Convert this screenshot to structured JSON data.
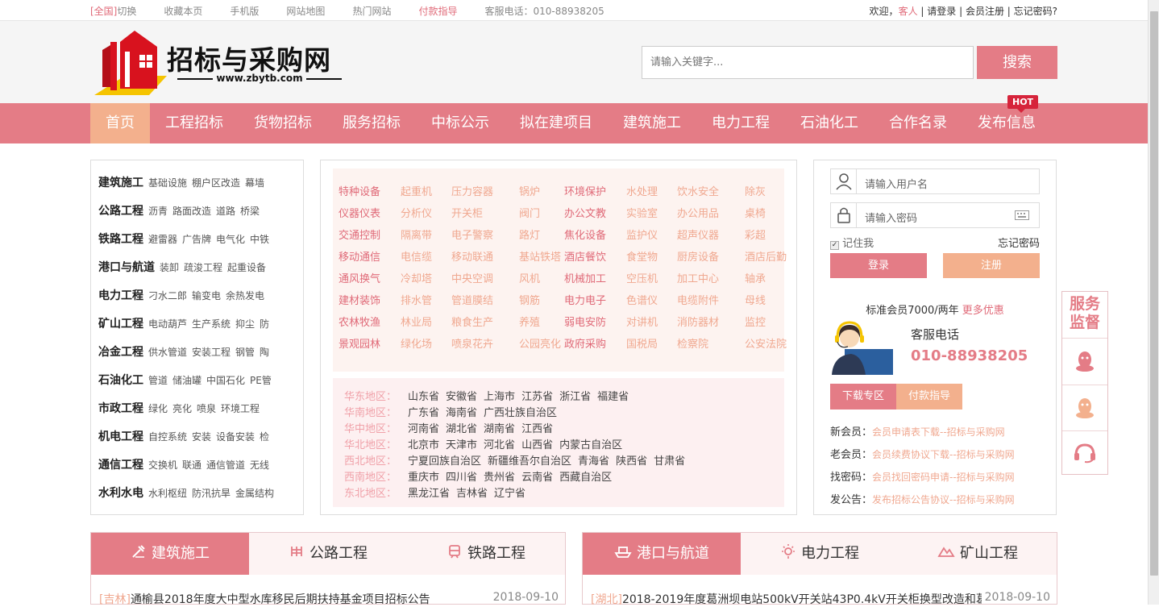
{
  "topbar": {
    "region_tag": "[全国]",
    "switch": "切换",
    "links": [
      "收藏本页",
      "手机版",
      "网站地图",
      "热门网站",
      "付款指导"
    ],
    "hotline": "客服电话：010-88938205",
    "welcome": "欢迎，",
    "guest": "客人",
    "login": "请登录",
    "register": "会员注册",
    "forgot": "忘记密码?"
  },
  "header": {
    "logo_title": "招标与采购网",
    "logo_url": "www.zbytb.com",
    "search_placeholder": "请输入关键字...",
    "search_button": "搜索"
  },
  "nav": {
    "items": [
      "首页",
      "工程招标",
      "货物招标",
      "服务招标",
      "中标公示",
      "拟在建项目",
      "建筑施工",
      "电力工程",
      "石油化工",
      "合作名录",
      "发布信息"
    ],
    "hot_badge": "HOT"
  },
  "categories": [
    {
      "name": "建筑施工",
      "subs": [
        "基础设施",
        "棚户区改造",
        "幕墙"
      ]
    },
    {
      "name": "公路工程",
      "subs": [
        "沥青",
        "路面改造",
        "道路",
        "桥梁"
      ]
    },
    {
      "name": "铁路工程",
      "subs": [
        "避雷器",
        "广告牌",
        "电气化",
        "中铁"
      ]
    },
    {
      "name": "港口与航道",
      "subs": [
        "装卸",
        "疏浚工程",
        "起重设备"
      ]
    },
    {
      "name": "电力工程",
      "subs": [
        "刁水二郎",
        "输变电",
        "余热发电"
      ]
    },
    {
      "name": "矿山工程",
      "subs": [
        "电动葫芦",
        "生产系统",
        "抑尘",
        "防"
      ]
    },
    {
      "name": "冶金工程",
      "subs": [
        "供水管道",
        "安装工程",
        "钢管",
        "陶"
      ]
    },
    {
      "name": "石油化工",
      "subs": [
        "管道",
        "储油罐",
        "中国石化",
        "PE管"
      ]
    },
    {
      "name": "市政工程",
      "subs": [
        "绿化",
        "亮化",
        "喷泉",
        "环境工程"
      ]
    },
    {
      "name": "机电工程",
      "subs": [
        "自控系统",
        "安装",
        "设备安装",
        "检"
      ]
    },
    {
      "name": "通信工程",
      "subs": [
        "交换机",
        "联通",
        "通信管道",
        "无线"
      ]
    },
    {
      "name": "水利水电",
      "subs": [
        "水利枢纽",
        "防汛抗旱",
        "金属结构"
      ]
    }
  ],
  "tags": [
    [
      "特种设备",
      "起重机",
      "压力容器",
      "锅炉",
      "环境保护",
      "水处理",
      "饮水安全",
      "除灰"
    ],
    [
      "仪器仪表",
      "分析仪",
      "开关柜",
      "阀门",
      "办公文教",
      "实验室",
      "办公用品",
      "桌椅"
    ],
    [
      "交通控制",
      "隔离带",
      "电子警察",
      "路灯",
      "焦化设备",
      "监护仪",
      "超声仪器",
      "彩超"
    ],
    [
      "移动通信",
      "电信缆",
      "移动联通",
      "基站铁塔",
      "酒店餐饮",
      "食堂物",
      "厨房设备",
      "酒店后勤"
    ],
    [
      "通风换气",
      "冷却塔",
      "中央空调",
      "风机",
      "机械加工",
      "空压机",
      "加工中心",
      "轴承"
    ],
    [
      "建材装饰",
      "排水管",
      "管道膜结",
      "钢筋",
      "电力电子",
      "色谱仪",
      "电缆附件",
      "母线"
    ],
    [
      "农林牧渔",
      "林业局",
      "粮食生产",
      "养殖",
      "弱电安防",
      "对讲机",
      "消防器材",
      "监控"
    ],
    [
      "景观园林",
      "绿化场",
      "喷泉花卉",
      "公园亮化",
      "政府采购",
      "国税局",
      "检察院",
      "公安法院"
    ]
  ],
  "regions": [
    {
      "name": "华东地区：",
      "provinces": [
        "山东省",
        "安徽省",
        "上海市",
        "江苏省",
        "浙江省",
        "福建省"
      ]
    },
    {
      "name": "华南地区：",
      "provinces": [
        "广东省",
        "海南省",
        "广西壮族自治区"
      ]
    },
    {
      "name": "华中地区：",
      "provinces": [
        "河南省",
        "湖北省",
        "湖南省",
        "江西省"
      ]
    },
    {
      "name": "华北地区：",
      "provinces": [
        "北京市",
        "天津市",
        "河北省",
        "山西省",
        "内蒙古自治区"
      ]
    },
    {
      "name": "西北地区：",
      "provinces": [
        "宁夏回族自治区",
        "新疆维吾尔自治区",
        "青海省",
        "陕西省",
        "甘肃省"
      ]
    },
    {
      "name": "西南地区：",
      "provinces": [
        "重庆市",
        "四川省",
        "贵州省",
        "云南省",
        "西藏自治区"
      ]
    },
    {
      "name": "东北地区：",
      "provinces": [
        "黑龙江省",
        "吉林省",
        "辽宁省"
      ]
    }
  ],
  "login": {
    "username_placeholder": "请输入用户名",
    "password_placeholder": "请输入密码",
    "remember": "记住我",
    "forgot": "忘记密码",
    "login_button": "登录",
    "register_button": "注册",
    "member_price": "标准会员7000/两年",
    "more_offers": "更多优惠",
    "service_label": "客服电话",
    "service_phone": "010-88938205",
    "download_tab": "下载专区",
    "payment_tab": "付款指导",
    "links": [
      {
        "label": "新会员：",
        "text": "会员申请表下载--招标与采购网"
      },
      {
        "label": "老会员：",
        "text": "会员续费协议下载--招标与采购网"
      },
      {
        "label": "找密码：",
        "text": "会员找回密码申请--招标与采购网"
      },
      {
        "label": "发公告：",
        "text": "发布招标公告协议--招标与采购网"
      }
    ]
  },
  "sidefloat": {
    "title": "服务监督"
  },
  "bottom_left": {
    "tabs": [
      "建筑施工",
      "公路工程",
      "铁路工程"
    ],
    "news": {
      "region": "[吉林]",
      "title": "通榆县2018年度大中型水库移民后期扶持基金项目招标公告",
      "date": "2018-09-10"
    }
  },
  "bottom_right": {
    "tabs": [
      "港口与航道",
      "电力工程",
      "矿山工程"
    ],
    "news": {
      "region": "[湖北]",
      "title": "2018-2019年度葛洲坝电站500kV开关站43P0.4kV开关柜换型改造和葛洲",
      "date": "2018-09-10"
    }
  },
  "colors": {
    "accent": "#e47c86",
    "orange": "#f3b08d",
    "hot": "#d6243b"
  }
}
